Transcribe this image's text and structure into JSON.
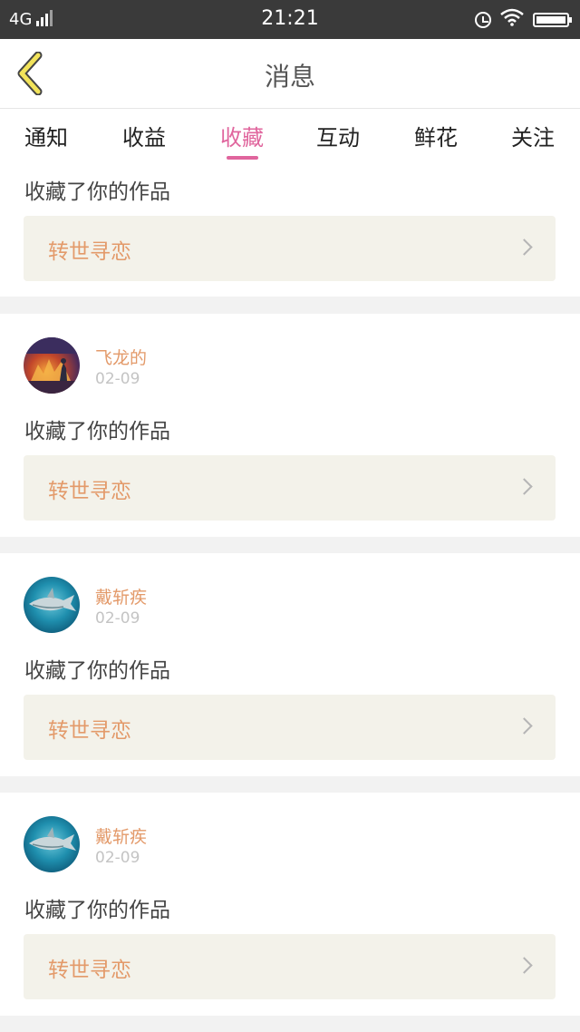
{
  "status": {
    "network": "4G",
    "time": "21:21"
  },
  "header": {
    "title": "消息"
  },
  "tabs": [
    "通知",
    "收益",
    "收藏",
    "互动",
    "鲜花",
    "关注"
  ],
  "active_tab": "收藏",
  "colors": {
    "accent_pink": "#e0659d",
    "name_orange": "#e39a6a",
    "work_box_bg": "#f3f2ea",
    "status_bar": "#3a3a3a"
  },
  "partial_card": {
    "action": "收藏了你的作品",
    "work": "转世寻恋"
  },
  "cards": [
    {
      "name": "飞龙的",
      "date": "02-09",
      "action": "收藏了你的作品",
      "work": "转世寻恋",
      "avatar": "fire-warrior-avatar"
    },
    {
      "name": "戴斩疾",
      "date": "02-09",
      "action": "收藏了你的作品",
      "work": "转世寻恋",
      "avatar": "shark-avatar"
    },
    {
      "name": "戴斩疾",
      "date": "02-09",
      "action": "收藏了你的作品",
      "work": "转世寻恋",
      "avatar": "shark-avatar"
    }
  ]
}
